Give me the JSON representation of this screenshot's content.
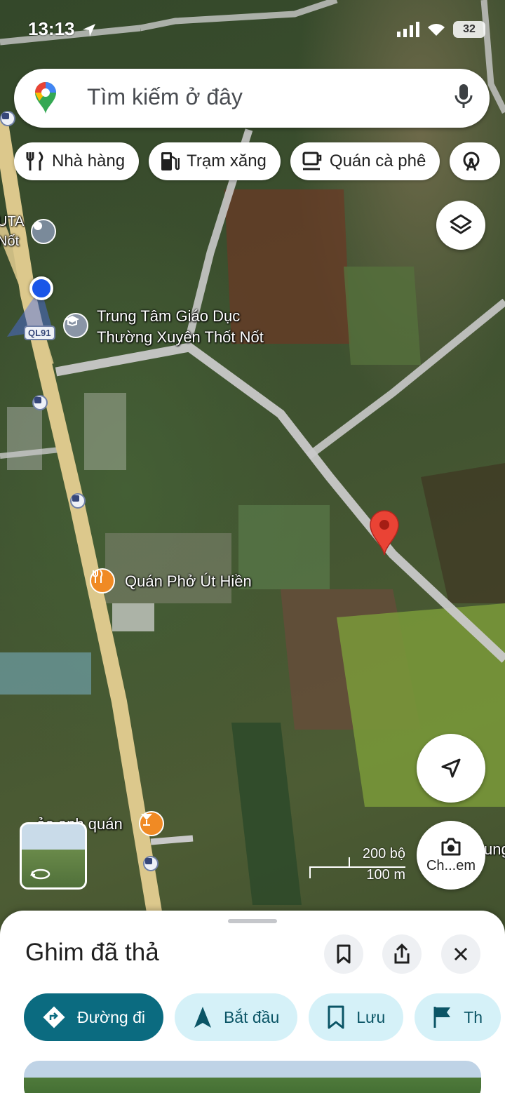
{
  "status_bar": {
    "time": "13:13",
    "battery": "32"
  },
  "search": {
    "placeholder": "Tìm kiếm ở đây"
  },
  "chips": [
    {
      "label": "Nhà hàng",
      "icon": "restaurant-icon"
    },
    {
      "label": "Trạm xăng",
      "icon": "gas-station-icon"
    },
    {
      "label": "Quán cà phê",
      "icon": "coffee-icon"
    },
    {
      "label": "",
      "icon": "attraction-icon"
    }
  ],
  "map": {
    "labels": {
      "school": "Trung Tâm Giáo Dục\nThường Xuyên Thốt Nốt",
      "pho": "Quán Phở Út Hiền",
      "bar": "...ảo anh quán",
      "left_poi": "UTA\nNốt",
      "right_edge": "ung"
    },
    "route_badge": "QL91",
    "scale": {
      "imperial": "200 bộ",
      "metric": "100 m"
    },
    "colors": {
      "road": "#dcc88c",
      "minor_road": "#c9c9c9",
      "pin": "#ea4335",
      "food_poi": "#f08a24"
    }
  },
  "camera_button": {
    "label": "Ch...em"
  },
  "sheet": {
    "title": "Ghim đã thả",
    "actions": [
      {
        "label": "Đường đi",
        "icon": "directions-icon"
      },
      {
        "label": "Bắt đầu",
        "icon": "navigation-arrow-icon"
      },
      {
        "label": "Lưu",
        "icon": "bookmark-icon"
      },
      {
        "label": "Th",
        "icon": "flag-icon"
      }
    ],
    "accent_color": "#0b6b80"
  }
}
